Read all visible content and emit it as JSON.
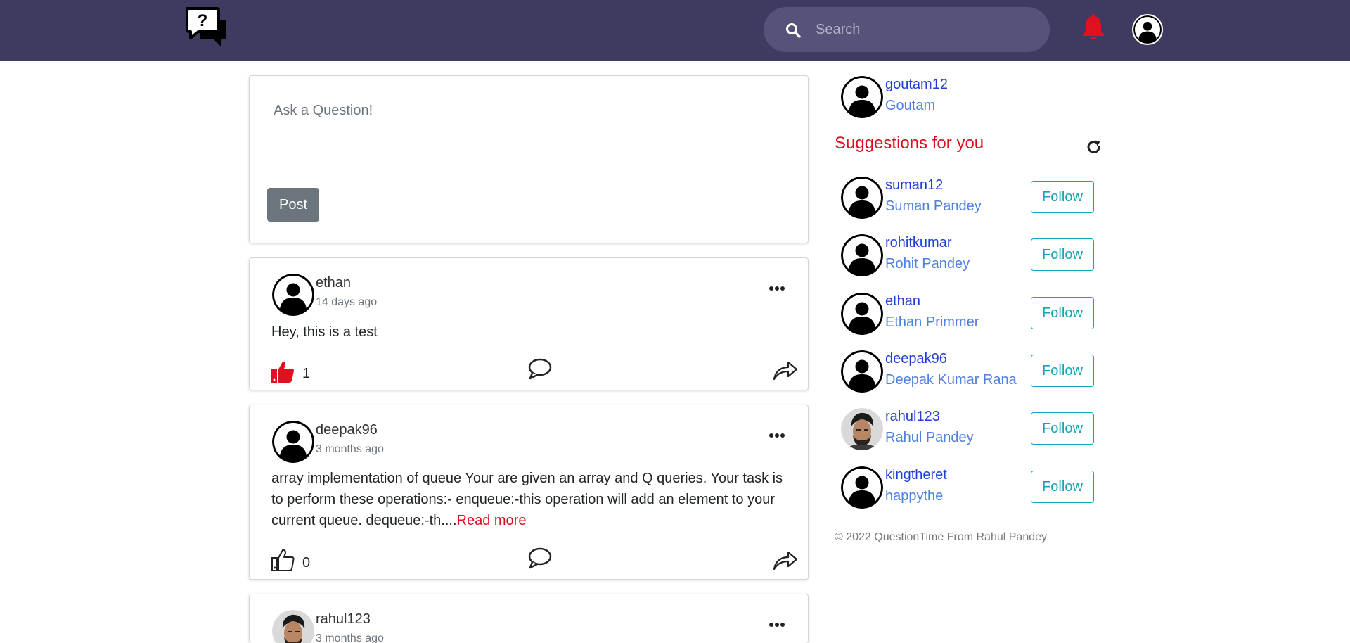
{
  "header": {
    "logo_icon": "question-chat-icon",
    "search_placeholder": "Search",
    "search_icon": "search-icon",
    "bell_icon": "bell-icon",
    "bell_color": "#e1101f",
    "avatar_icon": "user-avatar-icon"
  },
  "ask": {
    "placeholder": "Ask a Question!",
    "post_label": "Post"
  },
  "posts": [
    {
      "user": "ethan",
      "time": "14 days ago",
      "text": "Hey, this is a test",
      "read_more": "",
      "likes": "1",
      "liked": true
    },
    {
      "user": "deepak96",
      "time": "3 months ago",
      "text": "array implementation of queue Your are given an array and Q queries. Your task is to perform these operations:- enqueue:-this operation will add an element to your current queue. dequeue:-th....",
      "read_more": "Read more",
      "likes": "0",
      "liked": false
    },
    {
      "user": "rahul123",
      "time": "3 months ago",
      "text": "",
      "read_more": "",
      "likes": "",
      "liked": false
    }
  ],
  "sidebar": {
    "me": {
      "username": "goutam12",
      "name": "Goutam"
    },
    "suggestions_title": "Suggestions for you",
    "refresh_icon": "refresh-icon",
    "follow_label": "Follow",
    "suggestions": [
      {
        "username": "suman12",
        "name": "Suman Pandey"
      },
      {
        "username": "rohitkumar",
        "name": "Rohit Pandey"
      },
      {
        "username": "ethan",
        "name": "Ethan Primmer"
      },
      {
        "username": "deepak96",
        "name": "Deepak Kumar Rana"
      },
      {
        "username": "rahul123",
        "name": "Rahul Pandey"
      },
      {
        "username": "kingtheret",
        "name": "happythe"
      }
    ],
    "footer": "© 2022 QuestionTime From Rahul Pandey"
  },
  "colors": {
    "navbar": "#3f3a5f",
    "accent_red": "#dc0c1c",
    "follow_teal": "#17a2b8",
    "username_blue": "#1f3ed6"
  }
}
